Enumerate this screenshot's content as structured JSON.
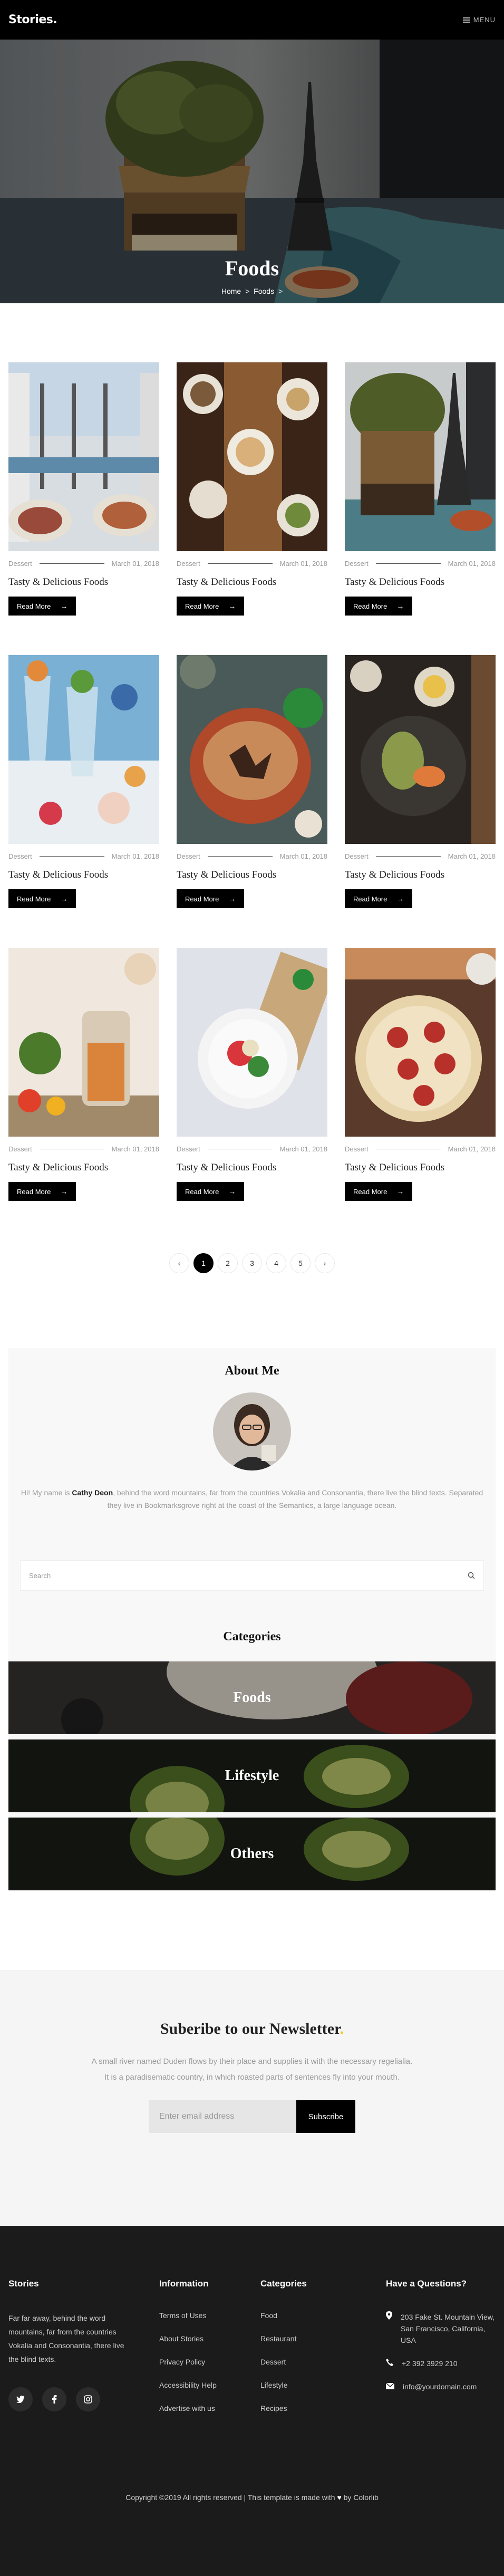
{
  "header": {
    "logo": "Stories",
    "logo_dot": ".",
    "menu_label": "MENU"
  },
  "hero": {
    "title": "Foods",
    "crumb_home": "Home",
    "crumb_sep": ">",
    "crumb_current": "Foods",
    "crumb_end": ">"
  },
  "posts": [
    {
      "category": "Dessert",
      "date": "March 01, 2018",
      "title": "Tasty & Delicious Foods",
      "button": "Read More"
    },
    {
      "category": "Dessert",
      "date": "March 01, 2018",
      "title": "Tasty & Delicious Foods",
      "button": "Read More"
    },
    {
      "category": "Dessert",
      "date": "March 01, 2018",
      "title": "Tasty & Delicious Foods",
      "button": "Read More"
    },
    {
      "category": "Dessert",
      "date": "March 01, 2018",
      "title": "Tasty & Delicious Foods",
      "button": "Read More"
    },
    {
      "category": "Dessert",
      "date": "March 01, 2018",
      "title": "Tasty & Delicious Foods",
      "button": "Read More"
    },
    {
      "category": "Dessert",
      "date": "March 01, 2018",
      "title": "Tasty & Delicious Foods",
      "button": "Read More"
    },
    {
      "category": "Dessert",
      "date": "March 01, 2018",
      "title": "Tasty & Delicious Foods",
      "button": "Read More"
    },
    {
      "category": "Dessert",
      "date": "March 01, 2018",
      "title": "Tasty & Delicious Foods",
      "button": "Read More"
    },
    {
      "category": "Dessert",
      "date": "March 01, 2018",
      "title": "Tasty & Delicious Foods",
      "button": "Read More"
    }
  ],
  "pagination": {
    "prev": "‹",
    "pages": [
      "1",
      "2",
      "3",
      "4",
      "5"
    ],
    "next": "›",
    "active": "1"
  },
  "sidebar": {
    "about_title": "About Me",
    "about_pre": "Hi! My name is ",
    "about_name": "Cathy Deon",
    "about_post": ", behind the word mountains, far from the countries Vokalia and Consonantia, there live the blind texts. Separated they live in Bookmarksgrove right at the coast of the Semantics, a large language ocean.",
    "search_placeholder": "Search",
    "categories_title": "Categories",
    "categories": [
      "Foods",
      "Lifestyle",
      "Others"
    ]
  },
  "newsletter": {
    "title": "Suberibe to our Newsletter",
    "title_dot": ".",
    "text": "A small river named Duden flows by their place and supplies it with the necessary regelialia. It is a paradisematic country, in which roasted parts of sentences fly into your mouth.",
    "email_placeholder": "Enter email address",
    "button": "Subscribe"
  },
  "footer": {
    "about_title": "Stories",
    "about_text": "Far far away, behind the word mountains, far from the countries Vokalia and Consonantia, there live the blind texts.",
    "info_title": "Information",
    "info_links": [
      "Terms of Uses",
      "About Stories",
      "Privacy Policy",
      "Accessibility Help",
      "Advertise with us"
    ],
    "cat_title": "Categories",
    "cat_links": [
      "Food",
      "Restaurant",
      "Dessert",
      "Lifestyle",
      "Recipes"
    ],
    "contact_title": "Have a Questions?",
    "address": "203 Fake St. Mountain View, San Francisco, California, USA",
    "phone": "+2 392 3929 210",
    "email": "info@yourdomain.com",
    "copyright_pre": "Copyright ©2019 All rights reserved | This template is made with",
    "copyright_heart": "♥",
    "copyright_post": "by Colorlib"
  },
  "colors": {
    "accent_dot": "#f5c518",
    "dark": "#000000",
    "footer_bg": "#1b1b1b"
  }
}
